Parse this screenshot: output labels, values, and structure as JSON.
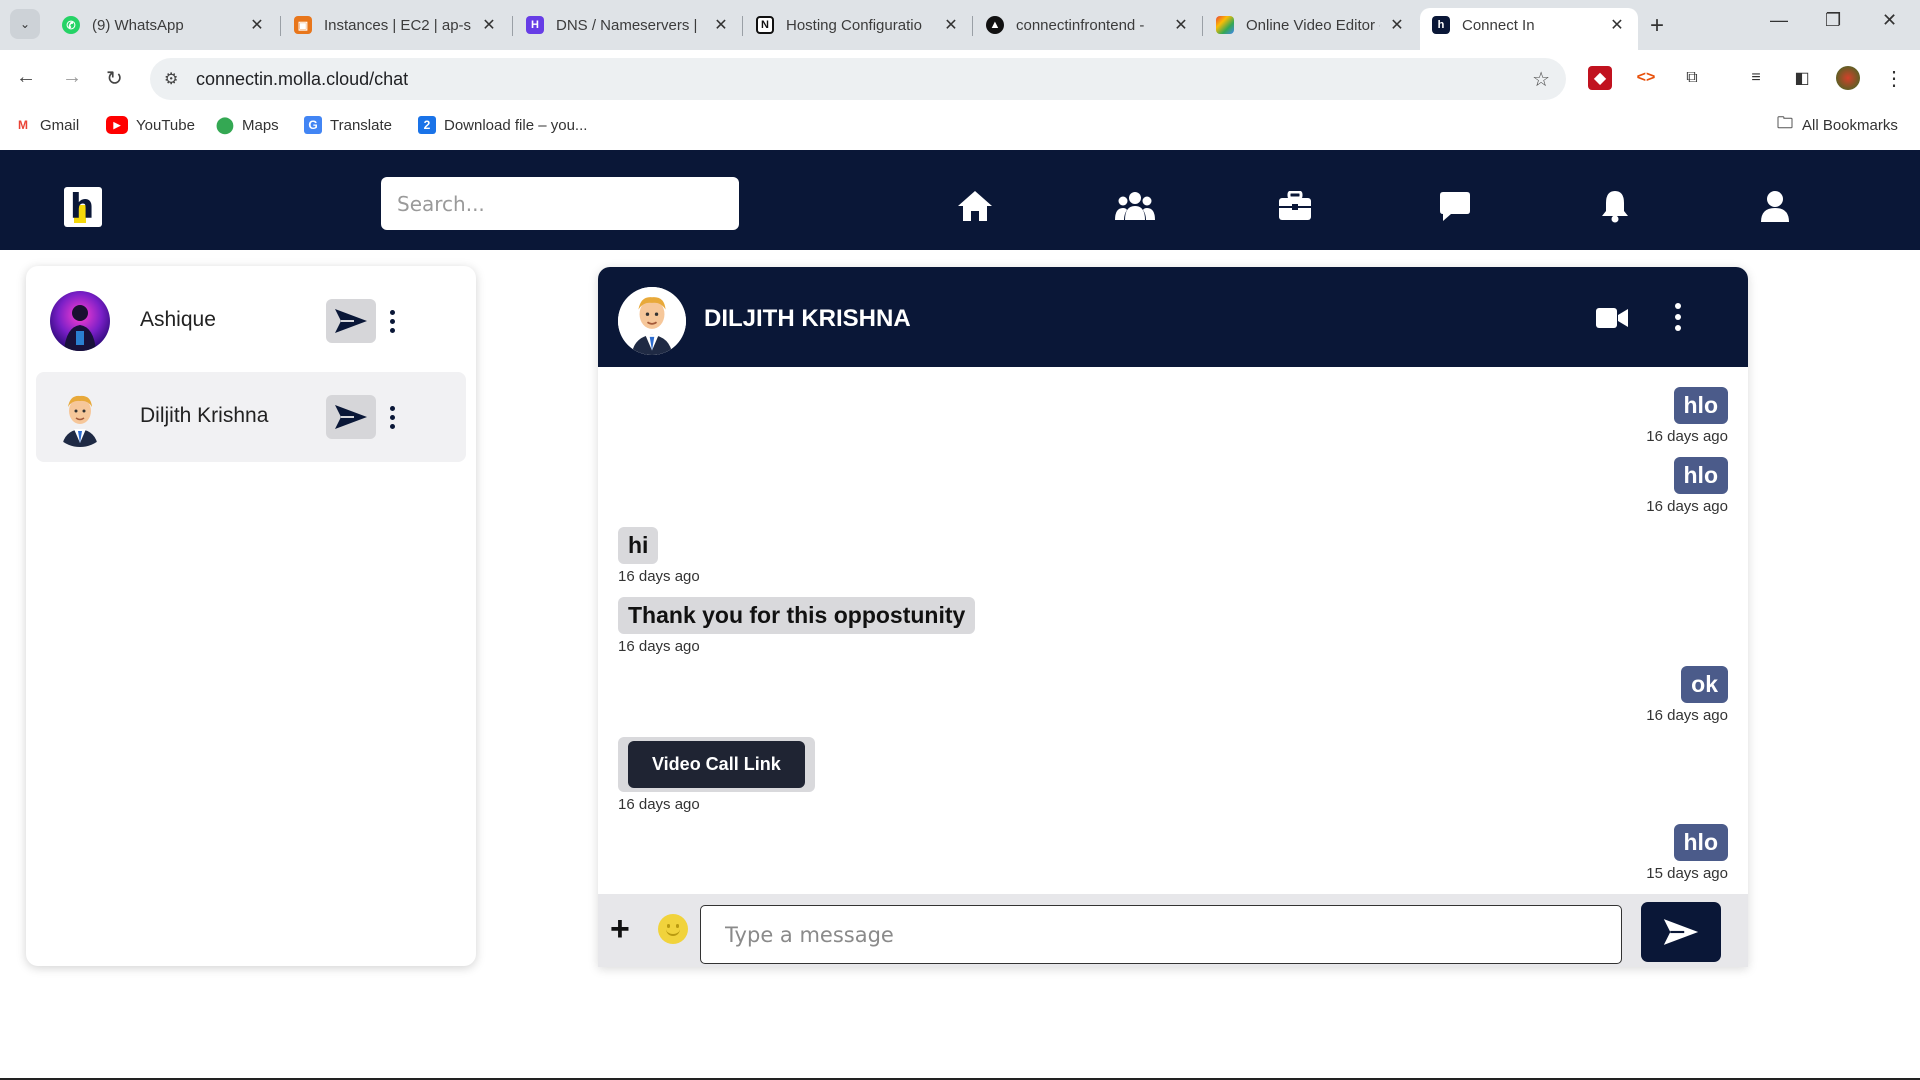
{
  "browser": {
    "tabs": [
      {
        "title": "(9) WhatsApp",
        "icon": "whatsapp-icon",
        "color": "#25d366"
      },
      {
        "title": "Instances | EC2 | ap-s",
        "icon": "aws-icon",
        "color": "#e8761b"
      },
      {
        "title": "DNS / Nameservers |",
        "icon": "hostinger-icon",
        "color": "#673de6"
      },
      {
        "title": "Hosting Configuratio",
        "icon": "notion-icon",
        "color": "#111111"
      },
      {
        "title": "connectinfrontend - ",
        "icon": "vercel-icon",
        "color": "#111111"
      },
      {
        "title": "Online Video Editor - ",
        "icon": "video-editor-icon",
        "color": "#4285f4"
      },
      {
        "title": "Connect In",
        "icon": "connectin-icon",
        "color": "#0a1737",
        "active": true
      }
    ],
    "url": "connectin.molla.cloud/chat",
    "bookmarks": [
      {
        "label": "Gmail",
        "icon": "gmail-icon"
      },
      {
        "label": "YouTube",
        "icon": "youtube-icon"
      },
      {
        "label": "Maps",
        "icon": "maps-icon"
      },
      {
        "label": "Translate",
        "icon": "translate-icon"
      },
      {
        "label": "Download file – you...",
        "icon": "download-icon"
      }
    ],
    "all_bookmarks": "All Bookmarks"
  },
  "header": {
    "search_placeholder": "Search..."
  },
  "contacts": [
    {
      "name": "Ashique",
      "selected": false
    },
    {
      "name": "Diljith Krishna",
      "selected": true
    }
  ],
  "chat": {
    "title": "DILJITH KRISHNA",
    "messages": [
      {
        "side": "out",
        "text": "hlo",
        "time": "16 days ago"
      },
      {
        "side": "out",
        "text": "hlo",
        "time": "16 days ago"
      },
      {
        "side": "in",
        "text": "hi",
        "time": "16 days ago"
      },
      {
        "side": "in",
        "text": "Thank you for this oppostunity",
        "time": "16 days ago"
      },
      {
        "side": "out",
        "text": "ok",
        "time": "16 days ago"
      },
      {
        "side": "in",
        "button": "Video Call Link",
        "time": "16 days ago"
      },
      {
        "side": "out",
        "text": "hlo",
        "time": "15 days ago"
      }
    ],
    "composer_placeholder": "Type a message"
  },
  "colors": {
    "navy": "#0a1737",
    "outgoing_bubble": "#4b5b8a",
    "incoming_bubble": "#d9d9dc"
  }
}
